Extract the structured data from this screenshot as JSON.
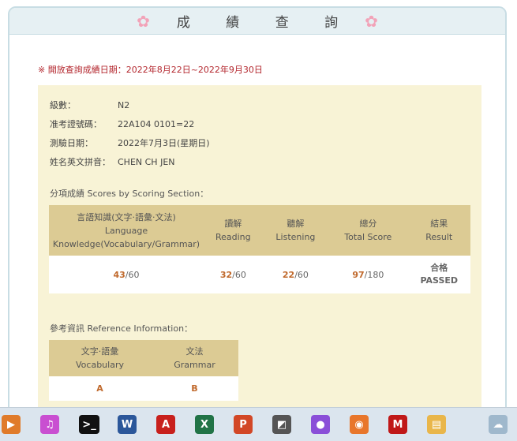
{
  "header": {
    "title": "成 績 查 詢"
  },
  "notice": "※ 開放查詢成績日期：2022年8月22日~2022年9月30日",
  "info": [
    {
      "label": "級數：",
      "value": "N2"
    },
    {
      "label": "准考證號碼：",
      "value": "22A104 0101=22"
    },
    {
      "label": "測驗日期：",
      "value": "2022年7月3日(星期日)"
    },
    {
      "label": "姓名英文拼音：",
      "value": "CHEN CH JEN"
    }
  ],
  "scores": {
    "title": "分項成績 Scores by Scoring Section：",
    "headers": [
      {
        "zh": "言語知識(文字‧語彙‧文法)",
        "en1": "Language",
        "en2": "Knowledge(Vocabulary/Grammar)"
      },
      {
        "zh": "讀解",
        "en1": "Reading"
      },
      {
        "zh": "聽解",
        "en1": "Listening"
      },
      {
        "zh": "總分",
        "en1": "Total Score"
      },
      {
        "zh": "結果",
        "en1": "Result"
      }
    ],
    "values": [
      {
        "score": "43",
        "max": "/60"
      },
      {
        "score": "32",
        "max": "/60"
      },
      {
        "score": "22",
        "max": "/60"
      },
      {
        "score": "97",
        "max": "/180"
      }
    ],
    "result_zh": "合格",
    "result_en": "PASSED"
  },
  "reference": {
    "title": "參考資訊 Reference Information：",
    "headers": [
      {
        "zh": "文字‧語彙",
        "en": "Vocabulary"
      },
      {
        "zh": "文法",
        "en": "Grammar"
      }
    ],
    "values": [
      "A",
      "B"
    ]
  },
  "taskbar": {
    "icons": [
      {
        "name": "media-player-icon",
        "glyph": "▶",
        "color": "#e07b2a"
      },
      {
        "name": "itunes-icon",
        "glyph": "♫",
        "color": "#c94fd1"
      },
      {
        "name": "terminal-icon",
        "glyph": ">_",
        "color": "#111111"
      },
      {
        "name": "word-icon",
        "glyph": "W",
        "color": "#2b579a"
      },
      {
        "name": "acrobat-icon",
        "glyph": "A",
        "color": "#c8201c"
      },
      {
        "name": "excel-icon",
        "glyph": "X",
        "color": "#217346"
      },
      {
        "name": "powerpoint-icon",
        "glyph": "P",
        "color": "#d24726"
      },
      {
        "name": "scanner-icon",
        "glyph": "◩",
        "color": "#555555"
      },
      {
        "name": "paint-icon",
        "glyph": "●",
        "color": "#8a4fd8"
      },
      {
        "name": "camera-icon",
        "glyph": "◉",
        "color": "#e8762b"
      },
      {
        "name": "mcafee-icon",
        "glyph": "M",
        "color": "#c01818"
      },
      {
        "name": "folder-icon",
        "glyph": "▤",
        "color": "#e9b64a"
      },
      {
        "name": "weather-icon",
        "glyph": "☁",
        "color": "#9fb8cc"
      }
    ]
  }
}
